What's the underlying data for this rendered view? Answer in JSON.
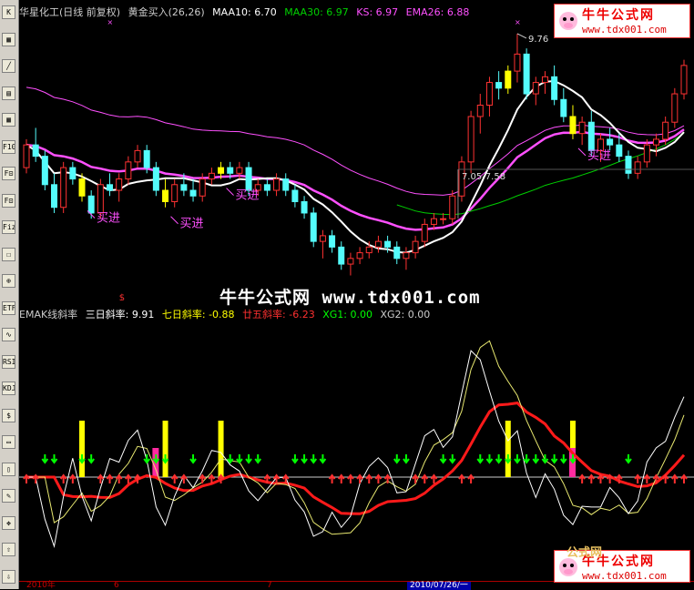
{
  "toolbar": {
    "icons": [
      "candle-chart",
      "table",
      "line-chart",
      "bar-view",
      "calendar",
      "f10-info",
      "f10-detail",
      "f10-news",
      "fiz",
      "letter-box",
      "zoom",
      "etf",
      "wave",
      "rsi",
      "kdj",
      "stock-s",
      "drawing",
      "export",
      "pencil",
      "move-arrows",
      "up-arrow",
      "down-arrow"
    ],
    "labels": [
      "K",
      "▦",
      "╱",
      "▤",
      "▦",
      "F10",
      "F⊡",
      "F⊡",
      "Fiz",
      "☐",
      "⊕",
      "ETF",
      "∿",
      "RSI",
      "KDJ",
      "$",
      "▭",
      "▯",
      "✎",
      "✥",
      "⇧",
      "⇩"
    ]
  },
  "header": {
    "title": "华星化工(日线 前复权)",
    "indicator": "黄金买入(26,26)",
    "items": [
      {
        "label": "MAA10: 6.70",
        "color": "#ffffff"
      },
      {
        "label": "MAA30: 6.97",
        "color": "#00d000"
      },
      {
        "label": "KS: 6.97",
        "color": "#ff50ff"
      },
      {
        "label": "EMA26: 6.88",
        "color": "#ff50ff"
      }
    ]
  },
  "price_panel": {
    "high_label": "9.76",
    "range_label": "7.05-7.58",
    "buy_label": "买进",
    "dollar_marker": "$"
  },
  "sub_header": {
    "name": "EMAK线斜率",
    "items": [
      {
        "label": "三日斜率: 9.91",
        "color": "#ffffff"
      },
      {
        "label": "七日斜率: -0.88",
        "color": "#ffff00"
      },
      {
        "label": "廿五斜率: -6.23",
        "color": "#ff3030"
      },
      {
        "label": "XG1: 0.00",
        "color": "#00ff00"
      },
      {
        "label": "XG2: 0.00",
        "color": "#cccccc"
      }
    ]
  },
  "watermark": "牛牛公式网 www.tdx001.com",
  "logo": {
    "name": "牛牛公式网",
    "url": "www.tdx001.com"
  },
  "logo_partial": "公式网",
  "axis": {
    "labels": [
      "2010年",
      "6",
      "7"
    ],
    "selected": "2010/07/26/一"
  },
  "colors": {
    "up": "#ff3232",
    "down": "#54fcfc",
    "yellow": "#ffff00",
    "white": "#ffffff",
    "magenta": "#ff50ff",
    "green": "#00d000"
  },
  "chart_data": {
    "type": "candlestick",
    "candles": [
      [
        7.4,
        7.9,
        7.3,
        7.8
      ],
      [
        7.8,
        8.1,
        7.5,
        7.6
      ],
      [
        7.6,
        7.7,
        7.0,
        7.1
      ],
      [
        7.1,
        7.3,
        6.6,
        6.7
      ],
      [
        6.7,
        7.5,
        6.6,
        7.4
      ],
      [
        7.4,
        7.5,
        7.1,
        7.2
      ],
      [
        7.2,
        7.3,
        6.8,
        6.9
      ],
      [
        6.9,
        7.0,
        6.5,
        6.6
      ],
      [
        6.6,
        7.2,
        6.5,
        7.1
      ],
      [
        7.1,
        7.3,
        6.9,
        7.0
      ],
      [
        7.0,
        7.3,
        6.8,
        7.2
      ],
      [
        7.2,
        7.6,
        7.1,
        7.5
      ],
      [
        7.5,
        7.8,
        7.4,
        7.7
      ],
      [
        7.7,
        7.8,
        7.3,
        7.4
      ],
      [
        7.4,
        7.5,
        6.9,
        7.0
      ],
      [
        7.0,
        7.2,
        6.7,
        6.8
      ],
      [
        6.8,
        7.2,
        6.7,
        7.1
      ],
      [
        7.1,
        7.3,
        6.9,
        7.0
      ],
      [
        7.0,
        7.2,
        6.8,
        6.9
      ],
      [
        6.9,
        7.3,
        6.8,
        7.2
      ],
      [
        7.2,
        7.4,
        7.1,
        7.3
      ],
      [
        7.3,
        7.5,
        7.2,
        7.4
      ],
      [
        7.4,
        7.5,
        7.2,
        7.3
      ],
      [
        7.3,
        7.5,
        7.2,
        7.4
      ],
      [
        7.4,
        7.5,
        6.9,
        7.0
      ],
      [
        7.0,
        7.2,
        6.9,
        7.1
      ],
      [
        7.1,
        7.2,
        6.9,
        7.0
      ],
      [
        7.0,
        7.3,
        6.9,
        7.2
      ],
      [
        7.2,
        7.3,
        6.9,
        7.0
      ],
      [
        7.0,
        7.1,
        6.7,
        6.8
      ],
      [
        6.8,
        6.9,
        6.5,
        6.6
      ],
      [
        6.6,
        6.7,
        6.0,
        6.1
      ],
      [
        6.1,
        6.3,
        5.8,
        6.2
      ],
      [
        6.2,
        6.3,
        5.9,
        6.0
      ],
      [
        6.0,
        6.1,
        5.6,
        5.7
      ],
      [
        5.7,
        5.9,
        5.5,
        5.8
      ],
      [
        5.8,
        6.0,
        5.7,
        5.9
      ],
      [
        5.9,
        6.1,
        5.8,
        6.0
      ],
      [
        6.0,
        6.2,
        5.9,
        6.1
      ],
      [
        6.1,
        6.2,
        5.9,
        6.0
      ],
      [
        6.0,
        6.1,
        5.7,
        5.8
      ],
      [
        5.8,
        6.0,
        5.6,
        5.9
      ],
      [
        5.9,
        6.2,
        5.8,
        6.1
      ],
      [
        6.1,
        6.5,
        6.0,
        6.4
      ],
      [
        6.4,
        6.6,
        6.3,
        6.5
      ],
      [
        6.5,
        6.6,
        6.4,
        6.5
      ],
      [
        6.5,
        7.0,
        6.4,
        6.9
      ],
      [
        6.9,
        7.6,
        6.8,
        7.5
      ],
      [
        7.5,
        8.4,
        7.3,
        8.3
      ],
      [
        8.3,
        8.7,
        8.0,
        8.5
      ],
      [
        8.5,
        9.0,
        8.3,
        8.9
      ],
      [
        8.9,
        9.1,
        8.6,
        8.8
      ],
      [
        8.8,
        9.2,
        8.7,
        9.1
      ],
      [
        9.1,
        9.76,
        8.9,
        9.4
      ],
      [
        9.4,
        9.5,
        8.6,
        8.7
      ],
      [
        8.7,
        9.0,
        8.5,
        8.9
      ],
      [
        8.9,
        9.1,
        8.7,
        9.0
      ],
      [
        9.0,
        9.2,
        8.5,
        8.6
      ],
      [
        8.6,
        8.8,
        8.2,
        8.3
      ],
      [
        8.3,
        8.5,
        7.9,
        8.0
      ],
      [
        8.0,
        8.3,
        7.8,
        8.2
      ],
      [
        8.2,
        8.4,
        7.6,
        7.7
      ],
      [
        7.7,
        8.0,
        7.5,
        7.9
      ],
      [
        7.9,
        8.1,
        7.7,
        7.8
      ],
      [
        7.8,
        8.0,
        7.5,
        7.6
      ],
      [
        7.6,
        7.7,
        7.2,
        7.3
      ],
      [
        7.3,
        7.6,
        7.2,
        7.5
      ],
      [
        7.5,
        7.9,
        7.4,
        7.8
      ],
      [
        7.8,
        8.0,
        7.6,
        7.9
      ],
      [
        7.9,
        8.3,
        7.8,
        8.2
      ],
      [
        8.2,
        8.8,
        8.1,
        8.7
      ],
      [
        8.7,
        9.3,
        8.6,
        9.2
      ]
    ],
    "yellow_bar_index": [
      6,
      15,
      21,
      52,
      59
    ],
    "buy_signal_index": [
      6,
      15,
      21,
      59
    ]
  }
}
